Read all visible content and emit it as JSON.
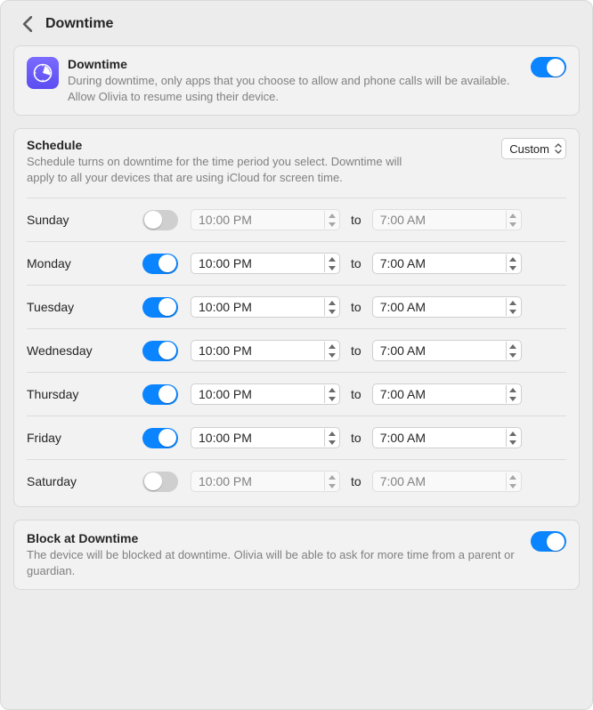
{
  "header": {
    "title": "Downtime"
  },
  "downtime": {
    "title": "Downtime",
    "description": "During downtime, only apps that you choose to allow and phone calls will be available. Allow Olivia to resume using their device.",
    "enabled": true
  },
  "schedule": {
    "title": "Schedule",
    "description": "Schedule turns on downtime for the time period you select. Downtime will apply to all your devices that are using iCloud for screen time.",
    "mode_label": "Custom",
    "to_label": "to",
    "days": [
      {
        "name": "Sunday",
        "on": false,
        "from": "10:00 PM",
        "to": "7:00 AM"
      },
      {
        "name": "Monday",
        "on": true,
        "from": "10:00 PM",
        "to": "7:00 AM"
      },
      {
        "name": "Tuesday",
        "on": true,
        "from": "10:00 PM",
        "to": "7:00 AM"
      },
      {
        "name": "Wednesday",
        "on": true,
        "from": "10:00 PM",
        "to": "7:00 AM"
      },
      {
        "name": "Thursday",
        "on": true,
        "from": "10:00 PM",
        "to": "7:00 AM"
      },
      {
        "name": "Friday",
        "on": true,
        "from": "10:00 PM",
        "to": "7:00 AM"
      },
      {
        "name": "Saturday",
        "on": false,
        "from": "10:00 PM",
        "to": "7:00 AM"
      }
    ]
  },
  "block": {
    "title": "Block at Downtime",
    "description": "The device will be blocked at downtime. Olivia will be able to ask for more time from a parent or guardian.",
    "enabled": true
  }
}
